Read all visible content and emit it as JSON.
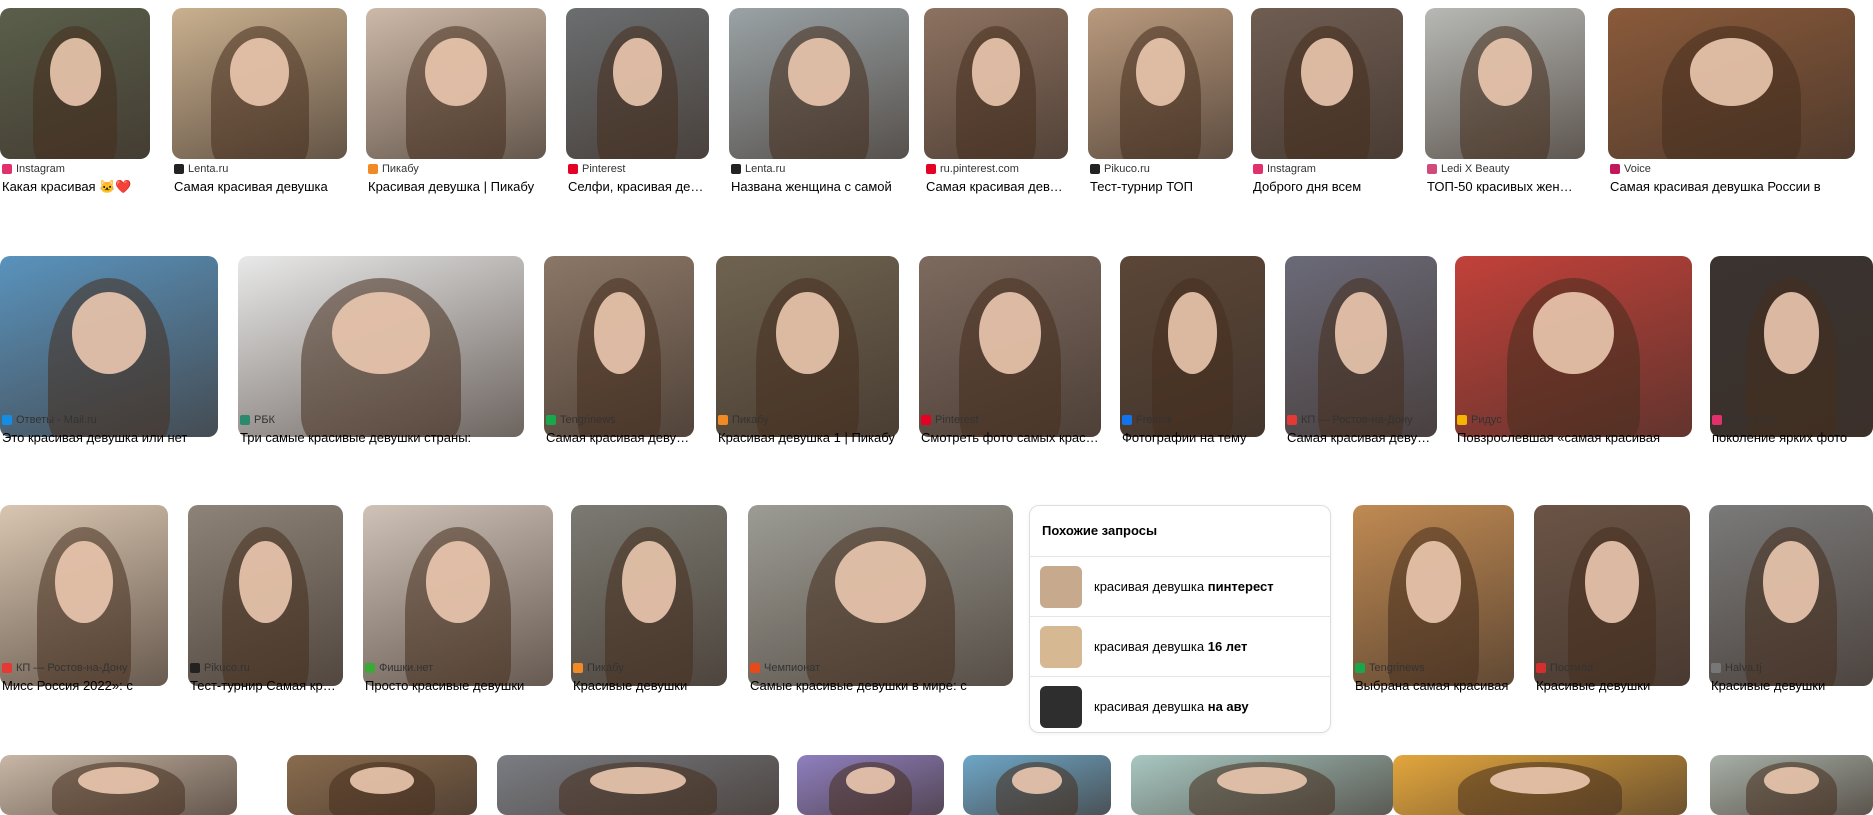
{
  "rows": [
    [
      {
        "source": "Instagram",
        "title": "Какая красивая 🐱❤️",
        "icon": "instagram-icon",
        "color": "#e1306c",
        "bg": "#5a5f4b"
      },
      {
        "source": "Lenta.ru",
        "title": "Самая красивая девушка",
        "icon": "lenta-icon",
        "color": "#222222",
        "bg": "#c9b08f"
      },
      {
        "source": "Пикабу",
        "title": "Красивая девушка | Пикабу",
        "icon": "pikabu-icon",
        "color": "#f08a24",
        "bg": "#cdb9a8"
      },
      {
        "source": "Pinterest",
        "title": "Селфи, красивая девушка",
        "icon": "pinterest-icon",
        "color": "#e60023",
        "bg": "#6b6e70"
      },
      {
        "source": "Lenta.ru",
        "title": "Названа женщина с самой",
        "icon": "lenta-icon",
        "color": "#222222",
        "bg": "#9aa3a6"
      },
      {
        "source": "ru.pinterest.com",
        "title": "Самая красивая девушка",
        "icon": "pinterest-icon",
        "color": "#e60023",
        "bg": "#8d7260"
      },
      {
        "source": "Pikuco.ru",
        "title": "Тест-турнир ТОП",
        "icon": "pikuco-icon",
        "color": "#222222",
        "bg": "#b99a7e"
      },
      {
        "source": "Instagram",
        "title": "Доброго дня всем",
        "icon": "instagram-icon",
        "color": "#e1306c",
        "bg": "#6f5d52"
      },
      {
        "source": "Ledi X Beauty",
        "title": "ТОП-50 красивых женщин",
        "icon": "ledi-icon",
        "color": "#d04a7a",
        "bg": "#b7b9b5"
      },
      {
        "source": "Voice",
        "title": "Самая красивая девушка России в",
        "icon": "voice-icon",
        "color": "#c2185b",
        "bg": "#8a5a3a"
      }
    ],
    [
      {
        "source": "Ответы - Mail.ru",
        "title": "Это красивая девушка или нет",
        "icon": "mailru-icon",
        "color": "#168de2",
        "bg": "#5a93bd"
      },
      {
        "source": "РБК",
        "title": "Три самые красивые девушки страны:",
        "icon": "rbk-icon",
        "color": "#2b8a6e",
        "bg": "#e9e9e9"
      },
      {
        "source": "Tengrinews",
        "title": "Самая красивая девушка",
        "icon": "tengrinews-icon",
        "color": "#1aa64a",
        "bg": "#8b7767"
      },
      {
        "source": "Пикабу",
        "title": "Красивая девушка 1 | Пикабу",
        "icon": "pikabu-icon",
        "color": "#f08a24",
        "bg": "#6f6350"
      },
      {
        "source": "Pinterest",
        "title": "Смотреть фото самых красивых",
        "icon": "pinterest-icon",
        "color": "#e60023",
        "bg": "#7d6a5f"
      },
      {
        "source": "Freepik",
        "title": "Фотографии на тему",
        "icon": "freepik-icon",
        "color": "#1273eb",
        "bg": "#5b4637"
      },
      {
        "source": "КП — Ростов-на-Дону",
        "title": "Самая красивая девушка",
        "icon": "kp-icon",
        "color": "#e53935",
        "bg": "#6b6a78"
      },
      {
        "source": "Ридус",
        "title": "Повзрослевшая «самая красивая",
        "icon": "ridus-icon",
        "color": "#f5b400",
        "bg": "#c2413a"
      },
      {
        "source": "Instagram",
        "title": "поколение ярких фото",
        "icon": "instagram-icon",
        "color": "#e1306c",
        "bg": "#3a3330"
      }
    ],
    [
      {
        "source": "КП — Ростов-на-Дону",
        "title": "Мисс Россия 2022»: с",
        "icon": "kp-icon",
        "color": "#e53935",
        "bg": "#d9c6b1"
      },
      {
        "source": "Pikuco.ru",
        "title": "Тест-турнир Самая красивая",
        "icon": "pikuco-icon",
        "color": "#222222",
        "bg": "#8d8378"
      },
      {
        "source": "Фишки.нет",
        "title": "Просто красивые девушки",
        "icon": "fishki-icon",
        "color": "#3aa935",
        "bg": "#cfc3b8"
      },
      {
        "source": "Пикабу",
        "title": "Красивые девушки",
        "icon": "pikabu-icon",
        "color": "#f08a24",
        "bg": "#7b7a72"
      },
      {
        "source": "Чемпионат",
        "title": "Самые красивые девушки в мире: с",
        "icon": "championat-icon",
        "color": "#e64a19",
        "bg": "#9c9c94"
      },
      {
        "source": "Tengrinews",
        "title": "Выбрана самая красивая",
        "icon": "tengrinews-icon",
        "color": "#1aa64a",
        "bg": "#c08a52"
      },
      {
        "source": "Постила",
        "title": "Красивые девушки",
        "icon": "postila-icon",
        "color": "#d32f2f",
        "bg": "#6b5446"
      },
      {
        "source": "Halva.tj",
        "title": "Красивые девушки",
        "icon": "halva-icon",
        "color": "#777777",
        "bg": "#7a7a7a"
      }
    ],
    [
      {
        "bg": "#c8b7a6"
      },
      {
        "bg": "#8a6c4e"
      },
      {
        "bg": "#7a7d83"
      },
      {
        "bg": "#8f7fc0"
      },
      {
        "bg": "#6ea7c8"
      },
      {
        "bg": "#a8c7c1"
      },
      {
        "bg": "#e3a63d"
      },
      {
        "bg": "#a7b0a7"
      }
    ]
  ],
  "related": {
    "heading": "Похожие запросы",
    "items": [
      {
        "base": "красивая девушка ",
        "bold": "пинтерест"
      },
      {
        "base": "красивая девушка ",
        "bold": "16 лет"
      },
      {
        "base": "красивая девушка ",
        "bold": "на аву"
      }
    ]
  }
}
